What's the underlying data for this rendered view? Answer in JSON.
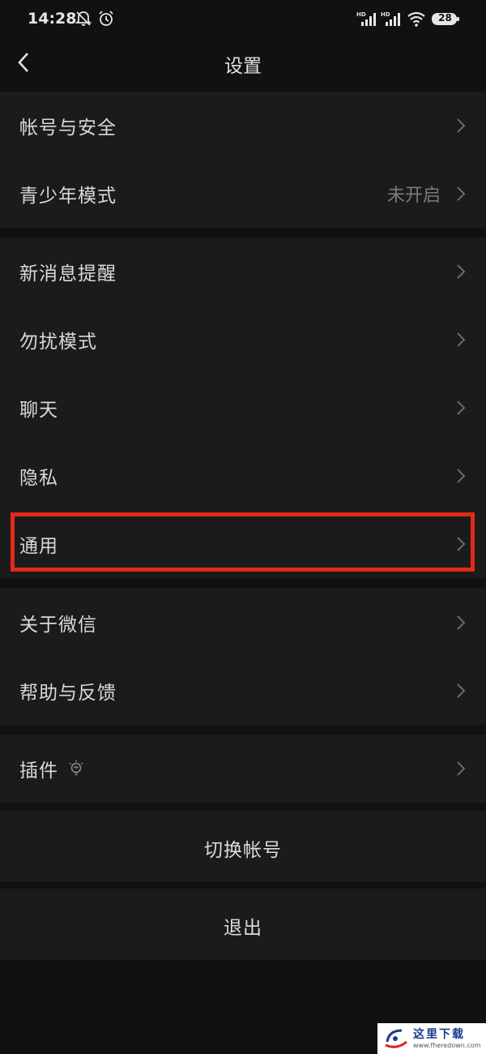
{
  "status_bar": {
    "time": "14:28",
    "icons": [
      "bell-off-icon",
      "alarm-icon",
      "hd-signal-icon",
      "hd-signal-icon",
      "wifi-icon",
      "battery-icon"
    ],
    "battery": "28"
  },
  "header": {
    "title": "设置",
    "back_icon": "chevron-left-icon"
  },
  "groups": [
    {
      "items": [
        {
          "label": "帐号与安全"
        },
        {
          "label": "青少年模式",
          "value": "未开启"
        }
      ]
    },
    {
      "items": [
        {
          "label": "新消息提醒"
        },
        {
          "label": "勿扰模式"
        },
        {
          "label": "聊天"
        },
        {
          "label": "隐私"
        },
        {
          "label": "通用",
          "highlighted": true
        }
      ]
    },
    {
      "items": [
        {
          "label": "关于微信"
        },
        {
          "label": "帮助与反馈"
        }
      ]
    },
    {
      "items": [
        {
          "label": "插件",
          "icon": "lightbulb-icon"
        }
      ]
    }
  ],
  "actions": {
    "switch_account": "切换帐号",
    "logout": "退出"
  },
  "colors": {
    "background": "#111111",
    "cell": "#1b1b1b",
    "highlight": "#e12a19"
  },
  "watermark": {
    "text": "这里下载",
    "url": "www.fheredown.com"
  }
}
